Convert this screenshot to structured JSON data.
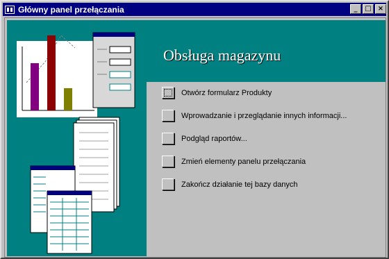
{
  "window": {
    "title": "Główny panel przełączania",
    "controls": {
      "minimize": "_",
      "maximize": "□",
      "close": "×"
    }
  },
  "header": {
    "title": "Obsługa magazynu",
    "background": "#008080"
  },
  "menu": {
    "items": [
      {
        "label": "Otwórz formularz Produkty"
      },
      {
        "label": "Wprowadzanie i przeglądanie innych informacji..."
      },
      {
        "label": "Podgląd raportów..."
      },
      {
        "label": "Zmień elementy panelu przełączania"
      },
      {
        "label": "Zakończ działanie tej bazy danych"
      }
    ]
  },
  "colors": {
    "title_bar": "#000080",
    "face": "#c0c0c0",
    "accent": "#008080"
  }
}
